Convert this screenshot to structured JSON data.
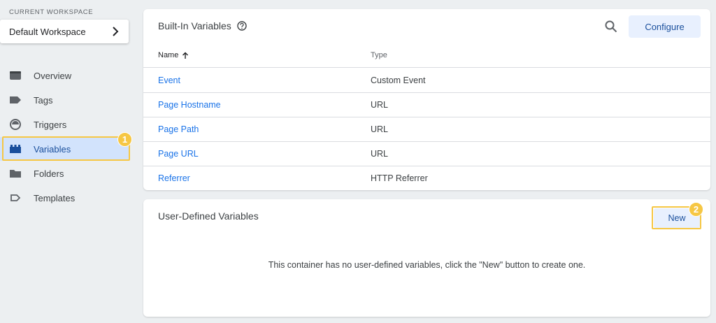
{
  "sidebar": {
    "workspace_label": "CURRENT WORKSPACE",
    "workspace_name": "Default Workspace",
    "items": [
      {
        "label": "Overview"
      },
      {
        "label": "Tags"
      },
      {
        "label": "Triggers"
      },
      {
        "label": "Variables"
      },
      {
        "label": "Folders"
      },
      {
        "label": "Templates"
      }
    ],
    "active_item": "Variables"
  },
  "builtin": {
    "title": "Built-In Variables",
    "configure_label": "Configure",
    "columns": {
      "name": "Name",
      "type": "Type"
    },
    "rows": [
      {
        "name": "Event",
        "type": "Custom Event"
      },
      {
        "name": "Page Hostname",
        "type": "URL"
      },
      {
        "name": "Page Path",
        "type": "URL"
      },
      {
        "name": "Page URL",
        "type": "URL"
      },
      {
        "name": "Referrer",
        "type": "HTTP Referrer"
      }
    ]
  },
  "user_defined": {
    "title": "User-Defined Variables",
    "new_label": "New",
    "empty_message": "This container has no user-defined variables, click the \"New\" button to create one."
  },
  "annotations": {
    "badge1": "1",
    "badge2": "2",
    "highlight_color": "#f6c744"
  },
  "colors": {
    "accent": "#1a73e8",
    "active_bg": "#d2e3fc",
    "button_bg": "#e8f0fe"
  }
}
